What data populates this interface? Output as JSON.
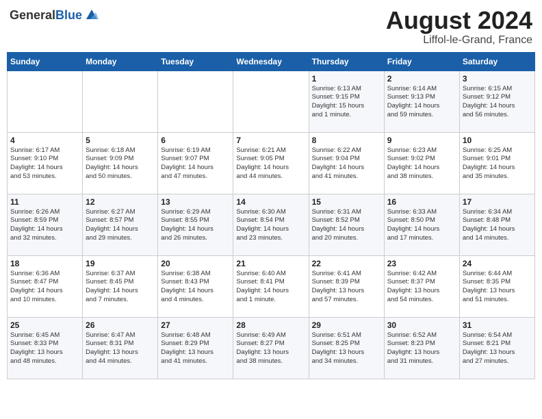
{
  "header": {
    "logo_general": "General",
    "logo_blue": "Blue",
    "month_year": "August 2024",
    "location": "Liffol-le-Grand, France"
  },
  "weekdays": [
    "Sunday",
    "Monday",
    "Tuesday",
    "Wednesday",
    "Thursday",
    "Friday",
    "Saturday"
  ],
  "weeks": [
    [
      {
        "day": "",
        "content": ""
      },
      {
        "day": "",
        "content": ""
      },
      {
        "day": "",
        "content": ""
      },
      {
        "day": "",
        "content": ""
      },
      {
        "day": "1",
        "content": "Sunrise: 6:13 AM\nSunset: 9:15 PM\nDaylight: 15 hours\nand 1 minute."
      },
      {
        "day": "2",
        "content": "Sunrise: 6:14 AM\nSunset: 9:13 PM\nDaylight: 14 hours\nand 59 minutes."
      },
      {
        "day": "3",
        "content": "Sunrise: 6:15 AM\nSunset: 9:12 PM\nDaylight: 14 hours\nand 56 minutes."
      }
    ],
    [
      {
        "day": "4",
        "content": "Sunrise: 6:17 AM\nSunset: 9:10 PM\nDaylight: 14 hours\nand 53 minutes."
      },
      {
        "day": "5",
        "content": "Sunrise: 6:18 AM\nSunset: 9:09 PM\nDaylight: 14 hours\nand 50 minutes."
      },
      {
        "day": "6",
        "content": "Sunrise: 6:19 AM\nSunset: 9:07 PM\nDaylight: 14 hours\nand 47 minutes."
      },
      {
        "day": "7",
        "content": "Sunrise: 6:21 AM\nSunset: 9:05 PM\nDaylight: 14 hours\nand 44 minutes."
      },
      {
        "day": "8",
        "content": "Sunrise: 6:22 AM\nSunset: 9:04 PM\nDaylight: 14 hours\nand 41 minutes."
      },
      {
        "day": "9",
        "content": "Sunrise: 6:23 AM\nSunset: 9:02 PM\nDaylight: 14 hours\nand 38 minutes."
      },
      {
        "day": "10",
        "content": "Sunrise: 6:25 AM\nSunset: 9:01 PM\nDaylight: 14 hours\nand 35 minutes."
      }
    ],
    [
      {
        "day": "11",
        "content": "Sunrise: 6:26 AM\nSunset: 8:59 PM\nDaylight: 14 hours\nand 32 minutes."
      },
      {
        "day": "12",
        "content": "Sunrise: 6:27 AM\nSunset: 8:57 PM\nDaylight: 14 hours\nand 29 minutes."
      },
      {
        "day": "13",
        "content": "Sunrise: 6:29 AM\nSunset: 8:55 PM\nDaylight: 14 hours\nand 26 minutes."
      },
      {
        "day": "14",
        "content": "Sunrise: 6:30 AM\nSunset: 8:54 PM\nDaylight: 14 hours\nand 23 minutes."
      },
      {
        "day": "15",
        "content": "Sunrise: 6:31 AM\nSunset: 8:52 PM\nDaylight: 14 hours\nand 20 minutes."
      },
      {
        "day": "16",
        "content": "Sunrise: 6:33 AM\nSunset: 8:50 PM\nDaylight: 14 hours\nand 17 minutes."
      },
      {
        "day": "17",
        "content": "Sunrise: 6:34 AM\nSunset: 8:48 PM\nDaylight: 14 hours\nand 14 minutes."
      }
    ],
    [
      {
        "day": "18",
        "content": "Sunrise: 6:36 AM\nSunset: 8:47 PM\nDaylight: 14 hours\nand 10 minutes."
      },
      {
        "day": "19",
        "content": "Sunrise: 6:37 AM\nSunset: 8:45 PM\nDaylight: 14 hours\nand 7 minutes."
      },
      {
        "day": "20",
        "content": "Sunrise: 6:38 AM\nSunset: 8:43 PM\nDaylight: 14 hours\nand 4 minutes."
      },
      {
        "day": "21",
        "content": "Sunrise: 6:40 AM\nSunset: 8:41 PM\nDaylight: 14 hours\nand 1 minute."
      },
      {
        "day": "22",
        "content": "Sunrise: 6:41 AM\nSunset: 8:39 PM\nDaylight: 13 hours\nand 57 minutes."
      },
      {
        "day": "23",
        "content": "Sunrise: 6:42 AM\nSunset: 8:37 PM\nDaylight: 13 hours\nand 54 minutes."
      },
      {
        "day": "24",
        "content": "Sunrise: 6:44 AM\nSunset: 8:35 PM\nDaylight: 13 hours\nand 51 minutes."
      }
    ],
    [
      {
        "day": "25",
        "content": "Sunrise: 6:45 AM\nSunset: 8:33 PM\nDaylight: 13 hours\nand 48 minutes."
      },
      {
        "day": "26",
        "content": "Sunrise: 6:47 AM\nSunset: 8:31 PM\nDaylight: 13 hours\nand 44 minutes."
      },
      {
        "day": "27",
        "content": "Sunrise: 6:48 AM\nSunset: 8:29 PM\nDaylight: 13 hours\nand 41 minutes."
      },
      {
        "day": "28",
        "content": "Sunrise: 6:49 AM\nSunset: 8:27 PM\nDaylight: 13 hours\nand 38 minutes."
      },
      {
        "day": "29",
        "content": "Sunrise: 6:51 AM\nSunset: 8:25 PM\nDaylight: 13 hours\nand 34 minutes."
      },
      {
        "day": "30",
        "content": "Sunrise: 6:52 AM\nSunset: 8:23 PM\nDaylight: 13 hours\nand 31 minutes."
      },
      {
        "day": "31",
        "content": "Sunrise: 6:54 AM\nSunset: 8:21 PM\nDaylight: 13 hours\nand 27 minutes."
      }
    ]
  ]
}
